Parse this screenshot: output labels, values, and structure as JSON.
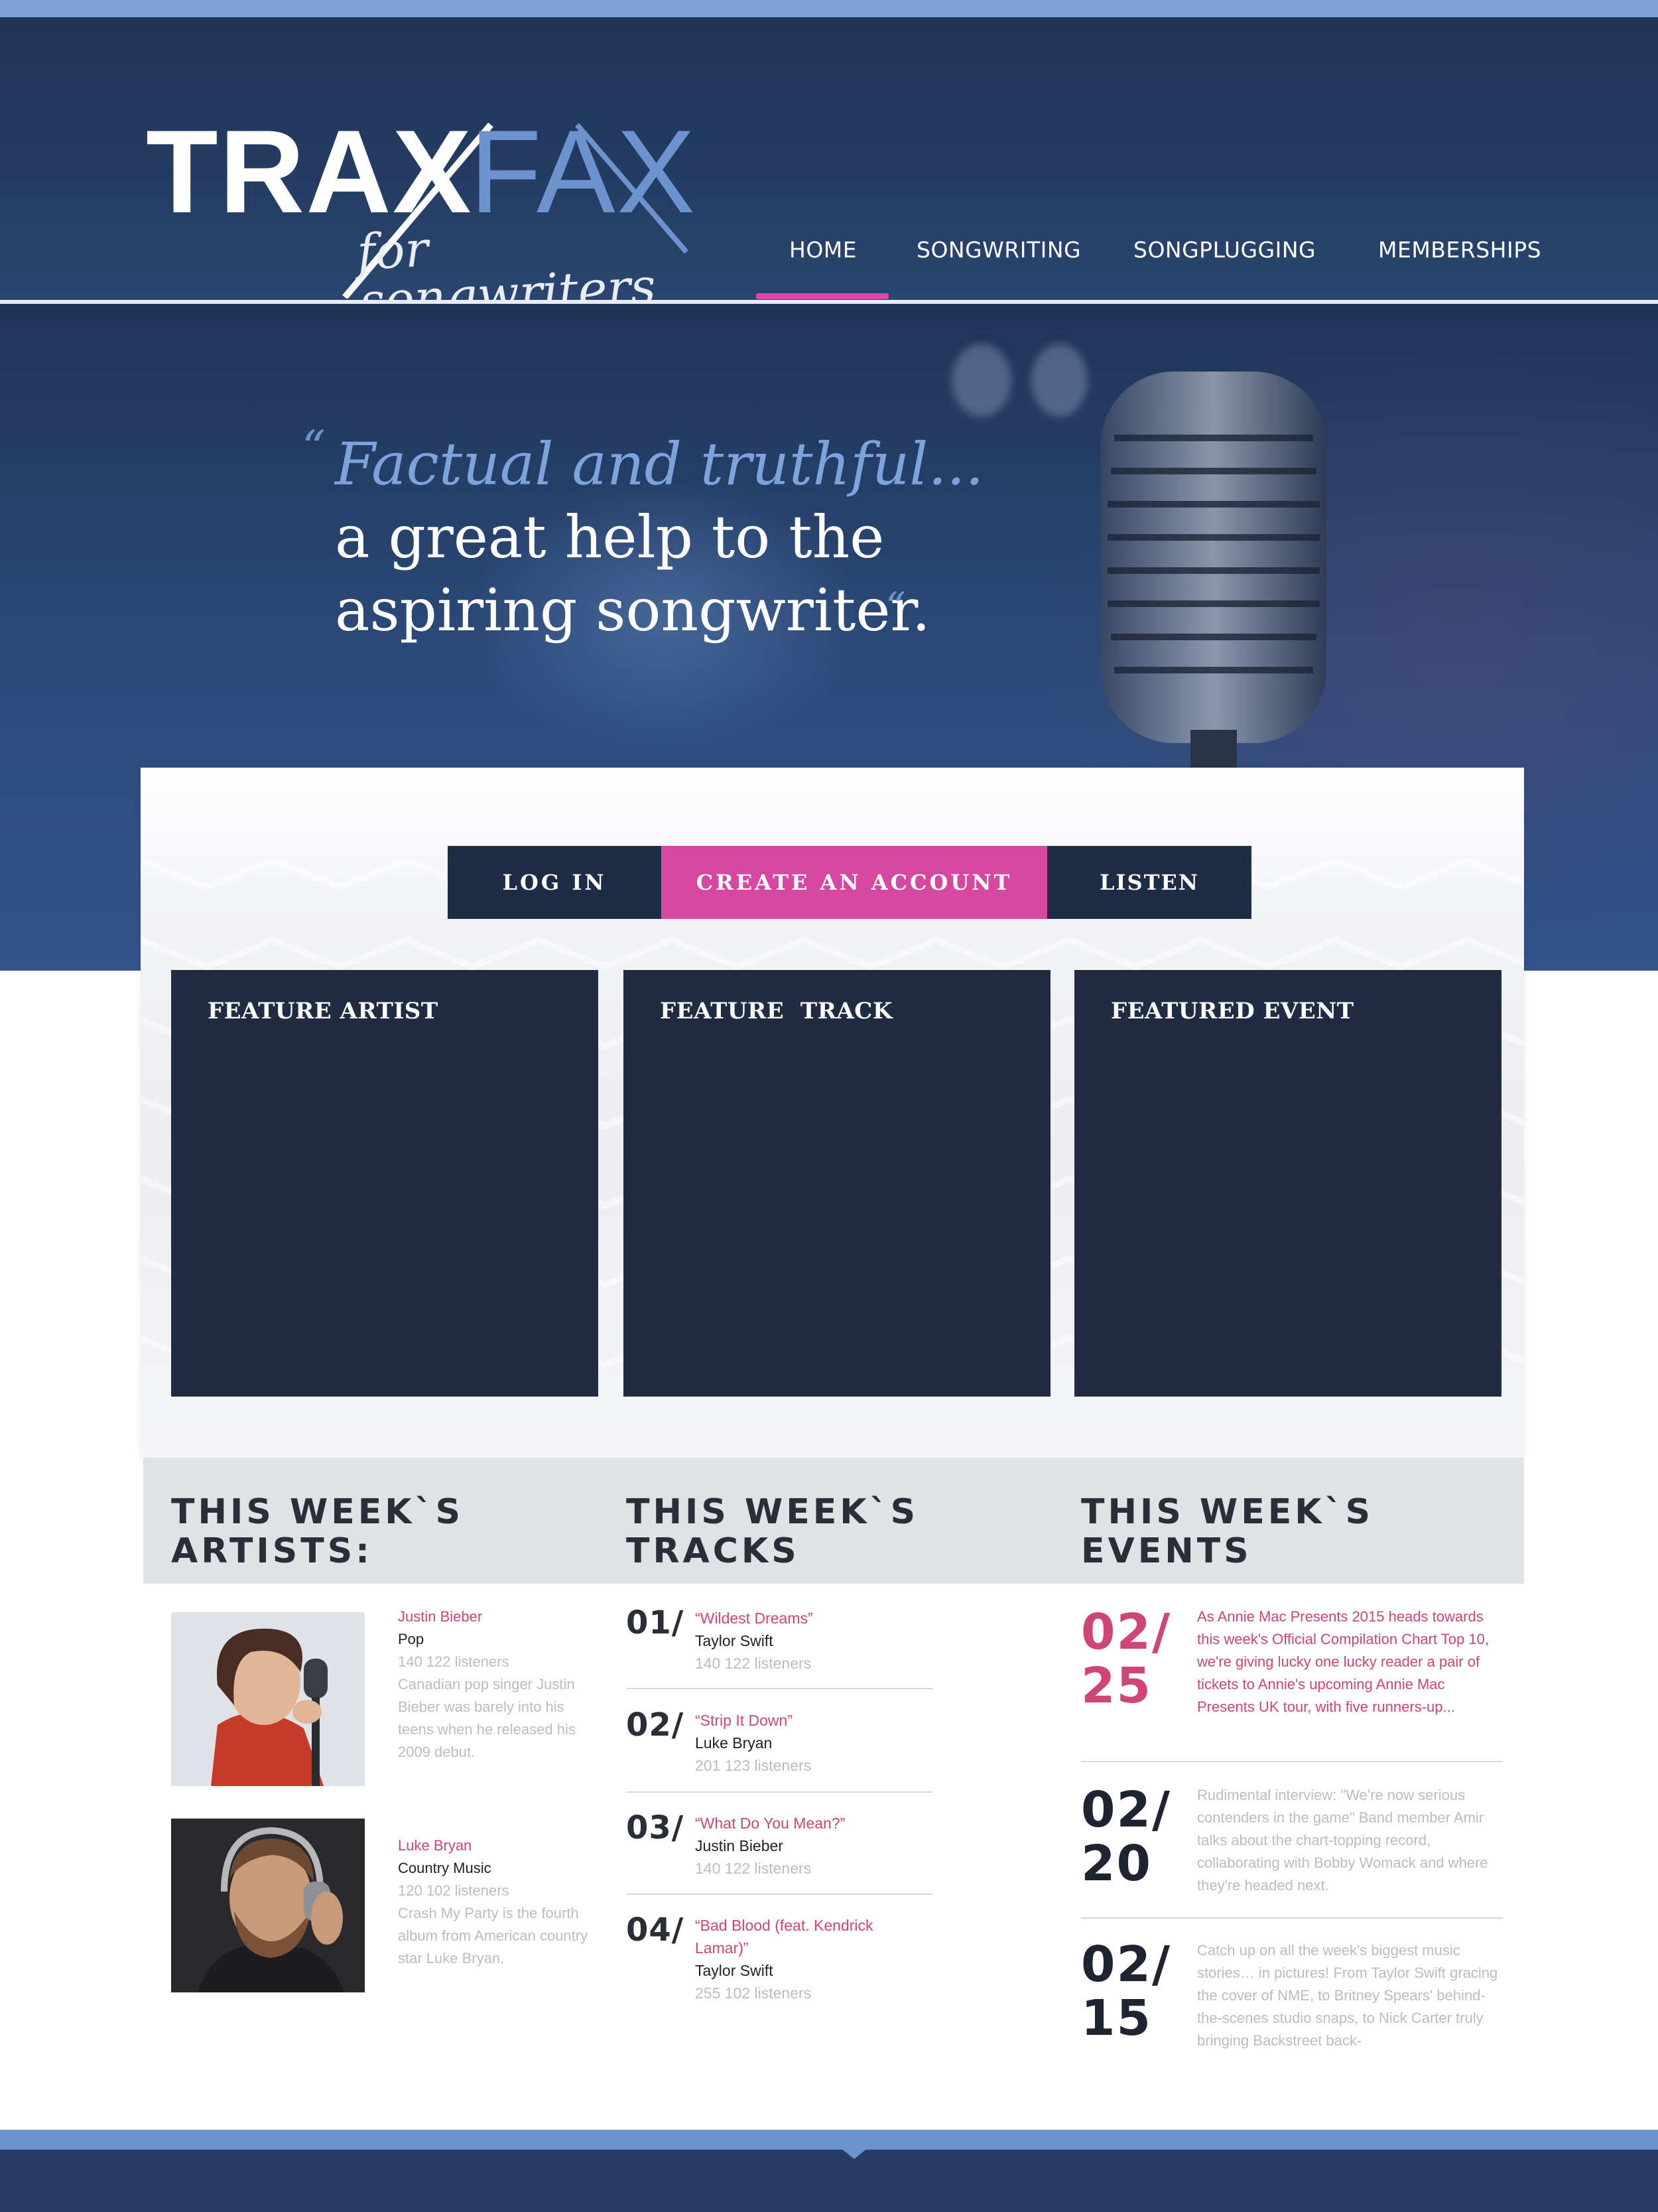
{
  "brand": {
    "logo_main": "TRAX",
    "logo_accent": "FAX",
    "logo_tagline": "for songwriters"
  },
  "nav": {
    "items": [
      {
        "label": "HOME",
        "active": true
      },
      {
        "label": "SONGWRITING",
        "active": false
      },
      {
        "label": "SONGPLUGGING",
        "active": false
      },
      {
        "label": "MEMBERSHIPS",
        "active": false
      }
    ]
  },
  "hero": {
    "quote_open": "“",
    "line1": "Factual and truthful...",
    "line2": "a great help to the",
    "line3": "aspiring songwriter.",
    "quote_close": "“"
  },
  "actions": {
    "login": "LOG IN",
    "create": "CREATE AN ACCOUNT",
    "listen": "LISTEN"
  },
  "features": [
    {
      "title": "FEATURE ARTIST"
    },
    {
      "title": "FEATURE  TRACK"
    },
    {
      "title": "FEATURED EVENT"
    }
  ],
  "weekly": {
    "artists_heading": [
      "THIS WEEK`S",
      "ARTISTS:"
    ],
    "tracks_heading": [
      "THIS WEEK`S",
      "TRACKS"
    ],
    "events_heading": [
      "THIS WEEK`S",
      "EVENTS"
    ],
    "artists": [
      {
        "name": "Justin Bieber",
        "genre": "Pop",
        "listeners": "140 122 listeners",
        "description": "Canadian pop singer Justin Bieber was barely into his teens when he released his 2009 debut."
      },
      {
        "name": "Luke Bryan",
        "genre": "Country Music",
        "listeners": "120 102 listeners",
        "description": "Crash My Party is the fourth album from American country star Luke Bryan."
      }
    ],
    "tracks": [
      {
        "num": "01/",
        "title": "“Wildest Dreams”",
        "artist": "Taylor Swift",
        "listeners": "140 122 listeners"
      },
      {
        "num": "02/",
        "title": "“Strip It Down”",
        "artist": "Luke Bryan",
        "listeners": "201 123 listeners"
      },
      {
        "num": "03/",
        "title": "“What Do You Mean?”",
        "artist": "Justin Bieber",
        "listeners": "140 122 listeners"
      },
      {
        "num": "04/",
        "title": "“Bad Blood (feat. Kendrick Lamar)”",
        "artist": "Taylor Swift",
        "listeners": "255 102 listeners"
      }
    ],
    "events": [
      {
        "month": "02/",
        "day": "25",
        "text": "As Annie Mac Presents 2015 heads towards this week's Official Compilation Chart Top 10, we're giving lucky one lucky reader a pair of tickets to Annie's upcoming Annie Mac Presents UK tour, with five runners-up..."
      },
      {
        "month": "02/",
        "day": "20",
        "text": "Rudimental interview: \"We're now serious contenders in the game\" Band member Amir talks about the chart-topping record, collaborating with Bobby Womack and where they're headed next."
      },
      {
        "month": "02/",
        "day": "15",
        "text": "Catch up on all the week's biggest music stories… in pictures! From Taylor Swift gracing the cover of NME, to Britney Spears' behind-the-scenes studio snaps, to Nick Carter truly bringing Backstreet back-"
      }
    ]
  },
  "colors": {
    "brand_blue": "#6d93cf",
    "navy": "#1f2c44",
    "accent_pink": "#d6479f",
    "text_pink": "#cf4577"
  }
}
